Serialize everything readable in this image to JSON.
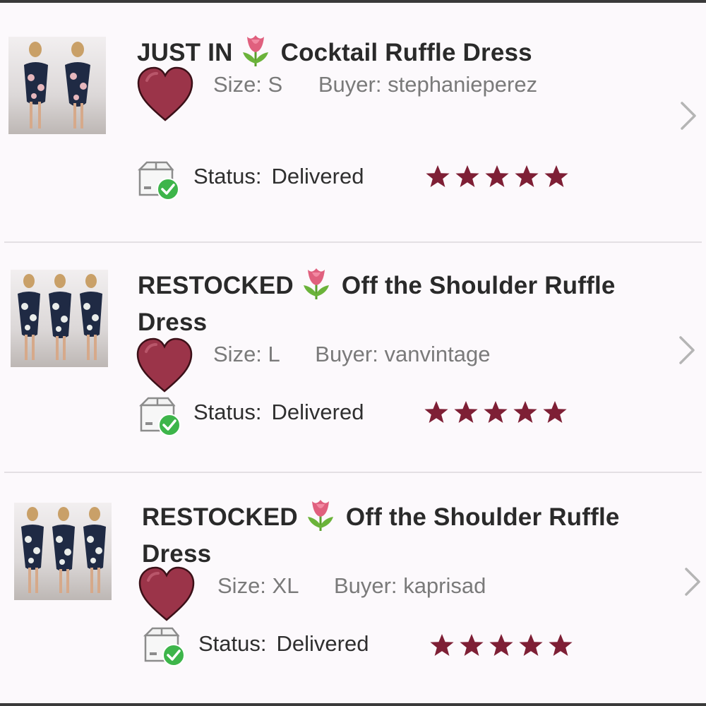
{
  "theme": {
    "accent": "#7e1f35",
    "heart_fill": "#9b3449",
    "check_green": "#3db54a",
    "meta_gray": "#7a7a7a"
  },
  "labels": {
    "size_prefix": "Size:",
    "buyer_prefix": "Buyer:",
    "status_prefix": "Status:"
  },
  "orders": [
    {
      "tag": "JUST IN",
      "tag_emoji_icon": "tulip-icon",
      "title": "Cocktail Ruffle Dress",
      "size": "S",
      "buyer": "stephanieperez",
      "status": "Delivered",
      "rating": 5,
      "rating_max": 5,
      "thumbnail_models": 2
    },
    {
      "tag": "RESTOCKED",
      "tag_emoji_icon": "tulip-icon",
      "title": "Off the Shoulder Ruffle Dress",
      "size": "L",
      "buyer": "vanvintage",
      "status": "Delivered",
      "rating": 5,
      "rating_max": 5,
      "thumbnail_models": 3
    },
    {
      "tag": "RESTOCKED",
      "tag_emoji_icon": "tulip-icon",
      "title": "Off the Shoulder Ruffle Dress",
      "size": "XL",
      "buyer": "kaprisad",
      "status": "Delivered",
      "rating": 5,
      "rating_max": 5,
      "thumbnail_models": 3
    }
  ]
}
